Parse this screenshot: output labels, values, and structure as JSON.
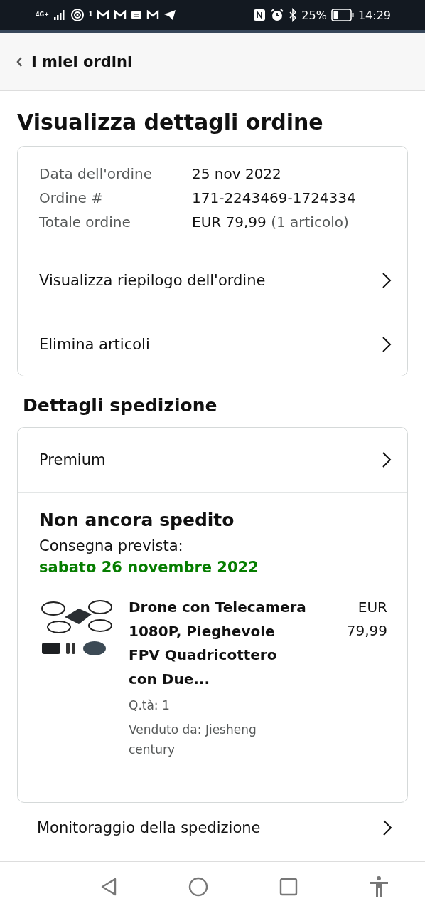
{
  "status_bar": {
    "network": "4G+",
    "hotspot_count": "1",
    "battery": "25%",
    "time": "14:29"
  },
  "header": {
    "back_label": "I miei ordini"
  },
  "title": "Visualizza dettagli ordine",
  "order_info": [
    {
      "label": "Data dell'ordine",
      "value": "25 nov 2022"
    },
    {
      "label": "Ordine #",
      "value": "171-2243469-1724334"
    },
    {
      "label": "Totale ordine",
      "value": "EUR 79,99",
      "note": "(1 articolo)"
    }
  ],
  "order_links": [
    "Visualizza riepilogo dell'ordine",
    "Elimina articoli"
  ],
  "shipping": {
    "heading": "Dettagli spedizione",
    "method": "Premium",
    "status": "Non ancora spedito",
    "delivery_label": "Consegna prevista:",
    "delivery_date": "sabato 26 novembre 2022",
    "item": {
      "title": "Drone con Telecamera 1080P, Pieghevole FPV Quadricottero con Due...",
      "price_currency": "EUR",
      "price_amount": "79,99",
      "quantity": "Q.tà: 1",
      "seller": "Venduto da: Jiesheng century"
    }
  },
  "tracking_link": "Monitoraggio della spedizione"
}
